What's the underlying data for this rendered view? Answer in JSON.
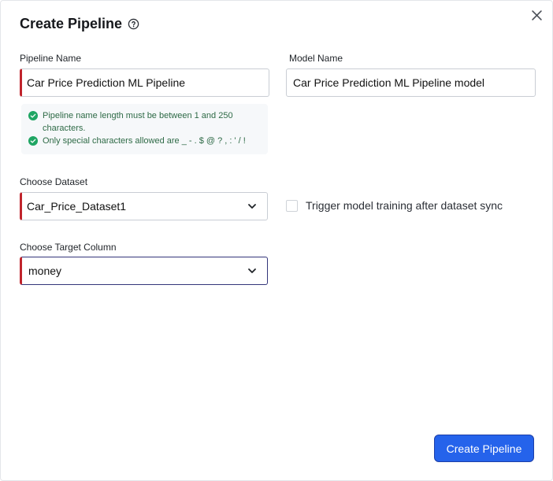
{
  "dialog": {
    "title": "Create Pipeline",
    "close_icon": "close-icon",
    "help_icon": "help-circle-icon"
  },
  "form": {
    "pipeline_name": {
      "label": "Pipeline Name",
      "value": "Car Price Prediction ML Pipeline"
    },
    "model_name": {
      "label": "Model Name",
      "value": "Car Price Prediction ML Pipeline model"
    },
    "validation": [
      {
        "icon": "check-circle-icon",
        "text": "Pipeline name length must be between 1 and 250 characters."
      },
      {
        "icon": "check-circle-icon",
        "text": "Only special characters allowed are _ - . $ @ ? , : ' / !"
      }
    ],
    "dataset": {
      "label": "Choose Dataset",
      "value": "Car_Price_Dataset1",
      "icon": "chevron-down-icon"
    },
    "target_column": {
      "label": "Choose Target Column",
      "value": "money",
      "icon": "chevron-down-icon"
    },
    "trigger_training": {
      "label": "Trigger model training after dataset sync",
      "checked": false
    }
  },
  "actions": {
    "create_label": "Create Pipeline"
  },
  "colors": {
    "primary": "#2563eb",
    "error_accent": "#c0242c",
    "success": "#1fa563",
    "success_text": "#2e6a46"
  }
}
